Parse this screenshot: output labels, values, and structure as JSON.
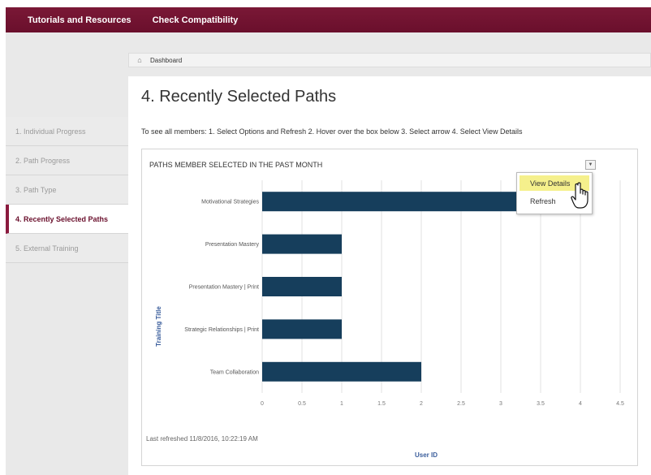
{
  "topbar": {
    "links": [
      "Tutorials and Resources",
      "Check Compatibility"
    ]
  },
  "breadcrumb": {
    "icon": "home-icon",
    "label": "Dashboard"
  },
  "sidebar": {
    "items": [
      {
        "label": "1. Individual Progress",
        "active": false
      },
      {
        "label": "2. Path Progress",
        "active": false
      },
      {
        "label": "3. Path Type",
        "active": false
      },
      {
        "label": "4. Recently Selected Paths",
        "active": true
      },
      {
        "label": "5. External Training",
        "active": false
      }
    ]
  },
  "main": {
    "title": "4. Recently Selected Paths",
    "instructions": "To see all members: 1. Select Options and Refresh 2. Hover over the box below 3. Select arrow 4. Select View Details"
  },
  "panel": {
    "title": "PATHS MEMBER SELECTED IN THE PAST MONTH",
    "menu_icon": "chevron-down-icon",
    "last_refreshed": "Last refreshed 11/8/2016, 10:22:19 AM",
    "menu": {
      "items": [
        "View Details",
        "Refresh"
      ],
      "hovered_index": 0
    }
  },
  "colors": {
    "brand": "#6a0f2c",
    "bar": "#163e5c",
    "axis_label": "#3b5e9c",
    "highlight": "#f5f08c"
  },
  "chart_data": {
    "type": "bar",
    "orientation": "horizontal",
    "categories": [
      "Motivational Strategies",
      "Presentation Mastery",
      "Presentation Mastery | Print",
      "Strategic Relationships | Print",
      "Team Collaboration"
    ],
    "values": [
      3.5,
      1,
      1,
      1,
      2
    ],
    "xlabel": "User ID",
    "ylabel": "Training Title",
    "xlim": [
      0,
      4.5
    ],
    "xticks": [
      "0",
      "0.5",
      "1",
      "1.5",
      "2",
      "2.5",
      "3",
      "3.5",
      "4",
      "4.5"
    ],
    "grid": true,
    "legend": "none"
  }
}
